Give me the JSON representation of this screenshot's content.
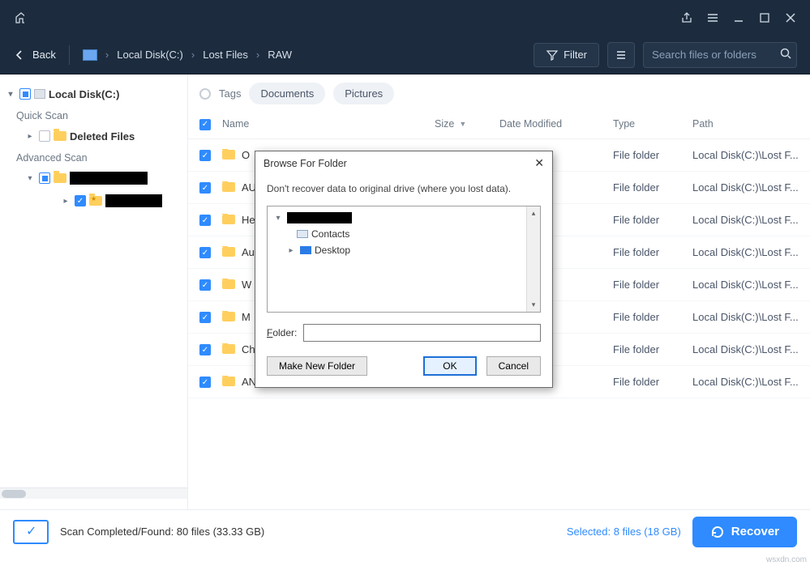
{
  "titlebar": {},
  "header": {
    "back": "Back",
    "crumbs": [
      "Local Disk(C:)",
      "Lost Files",
      "RAW"
    ],
    "filter": "Filter",
    "search_placeholder": "Search files or folders"
  },
  "sidebar": {
    "root": "Local Disk(C:)",
    "quick_scan_label": "Quick Scan",
    "deleted_files": "Deleted Files",
    "advanced_scan_label": "Advanced Scan"
  },
  "tags": {
    "label": "Tags",
    "pills": [
      "Documents",
      "Pictures"
    ]
  },
  "columns": {
    "name": "Name",
    "size": "Size",
    "date": "Date Modified",
    "type": "Type",
    "path": "Path"
  },
  "rows": [
    {
      "name": "O",
      "type": "File folder",
      "path": "Local Disk(C:)\\Lost F..."
    },
    {
      "name": "AU",
      "type": "File folder",
      "path": "Local Disk(C:)\\Lost F..."
    },
    {
      "name": "He",
      "type": "File folder",
      "path": "Local Disk(C:)\\Lost F..."
    },
    {
      "name": "Au",
      "type": "File folder",
      "path": "Local Disk(C:)\\Lost F..."
    },
    {
      "name": "W",
      "type": "File folder",
      "path": "Local Disk(C:)\\Lost F..."
    },
    {
      "name": "M",
      "type": "File folder",
      "path": "Local Disk(C:)\\Lost F..."
    },
    {
      "name": "Ch",
      "type": "File folder",
      "path": "Local Disk(C:)\\Lost F..."
    },
    {
      "name": "AN",
      "type": "File folder",
      "path": "Local Disk(C:)\\Lost F..."
    }
  ],
  "footer": {
    "status": "Scan Completed/Found: 80 files (33.33 GB)",
    "selected": "Selected: 8 files (18 GB)",
    "recover": "Recover"
  },
  "dialog": {
    "title": "Browse For Folder",
    "message": "Don't recover data to original drive (where you lost data).",
    "nodes": {
      "contacts": "Contacts",
      "desktop": "Desktop"
    },
    "folder_label": "Folder:",
    "make_new": "Make New Folder",
    "ok": "OK",
    "cancel": "Cancel"
  },
  "watermark": "wsxdn.com"
}
